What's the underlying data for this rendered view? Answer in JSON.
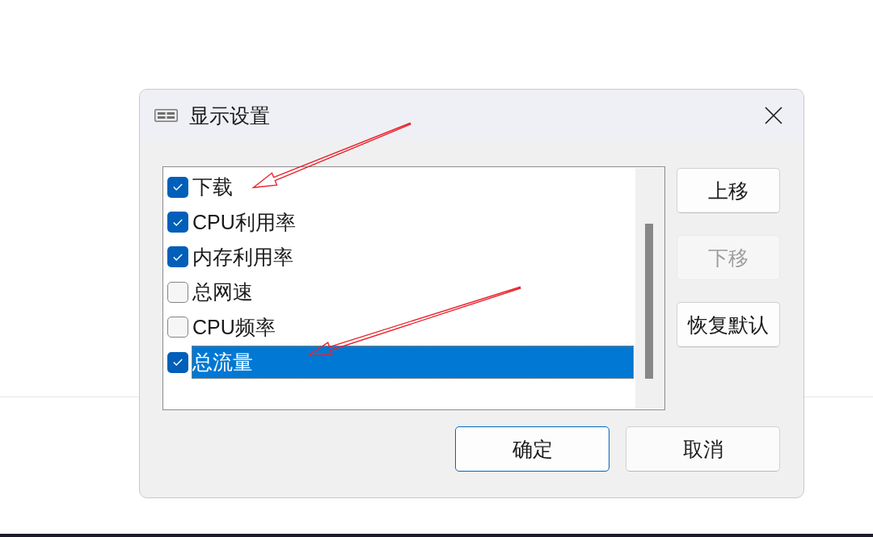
{
  "window": {
    "title": "显示设置"
  },
  "list": {
    "items": [
      {
        "label": "下载",
        "checked": true,
        "selected": false,
        "arrow": true
      },
      {
        "label": "CPU利用率",
        "checked": true,
        "selected": false,
        "arrow": false
      },
      {
        "label": "内存利用率",
        "checked": true,
        "selected": false,
        "arrow": false
      },
      {
        "label": "总网速",
        "checked": false,
        "selected": false,
        "arrow": false
      },
      {
        "label": "CPU频率",
        "checked": false,
        "selected": false,
        "arrow": false
      },
      {
        "label": "总流量",
        "checked": true,
        "selected": true,
        "arrow": true
      }
    ]
  },
  "side_buttons": [
    {
      "label": "上移",
      "disabled": false
    },
    {
      "label": "下移",
      "disabled": true
    },
    {
      "label": "恢复默认",
      "disabled": false
    }
  ],
  "footer_buttons": [
    {
      "label": "确定",
      "default": true
    },
    {
      "label": "取消",
      "default": false
    }
  ]
}
